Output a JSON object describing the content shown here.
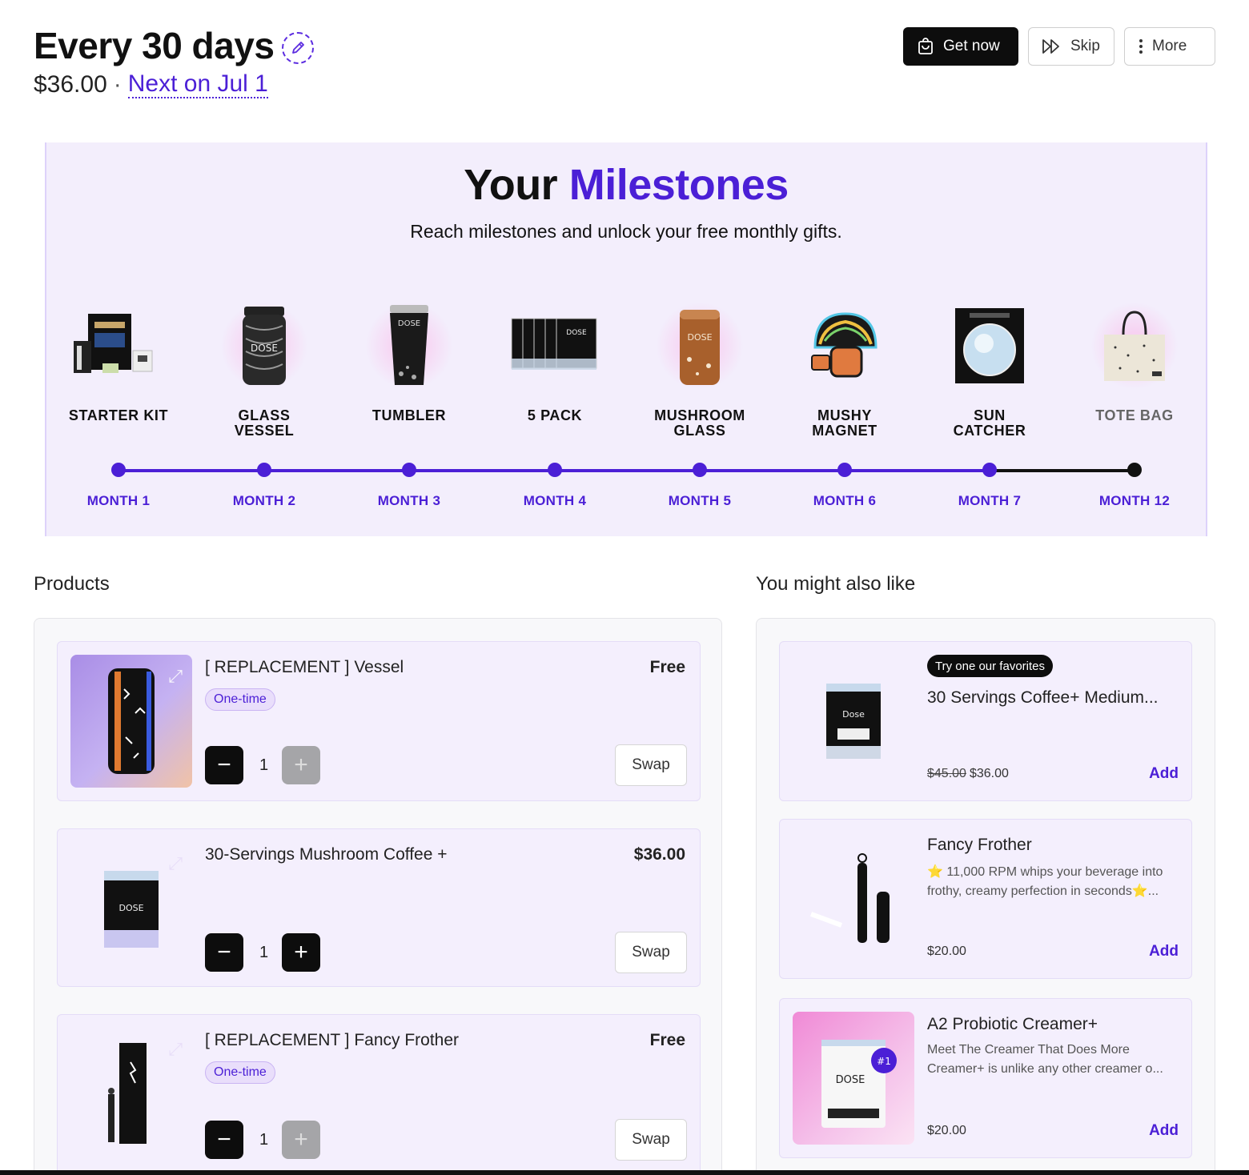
{
  "header": {
    "title": "Every 30 days",
    "price": "$36.00",
    "separator": "·",
    "next_label": "Next on Jul 1",
    "actions": {
      "get_now": "Get now",
      "skip": "Skip",
      "more": "More"
    }
  },
  "milestones": {
    "title_part1": "Your",
    "title_part2": "Milestones",
    "subtitle": "Reach milestones and unlock your free monthly gifts.",
    "items": [
      {
        "name_line1": "STARTER KIT",
        "name_line2": "",
        "month": "MONTH 1"
      },
      {
        "name_line1": "GLASS",
        "name_line2": "VESSEL",
        "month": "MONTH 2"
      },
      {
        "name_line1": "TUMBLER",
        "name_line2": "",
        "month": "MONTH 3"
      },
      {
        "name_line1": "5 PACK",
        "name_line2": "",
        "month": "MONTH 4"
      },
      {
        "name_line1": "MUSHROOM",
        "name_line2": "GLASS",
        "month": "MONTH 5"
      },
      {
        "name_line1": "MUSHY",
        "name_line2": "MAGNET",
        "month": "MONTH 6"
      },
      {
        "name_line1": "SUN",
        "name_line2": "CATCHER",
        "month": "MONTH 7"
      },
      {
        "name_line1": "TOTE BAG",
        "name_line2": "",
        "month": "MONTH 12"
      }
    ],
    "colors": {
      "reached": "#4b1fd6",
      "upcoming": "#111111"
    }
  },
  "products": {
    "section_title": "Products",
    "items": [
      {
        "name": "[ REPLACEMENT ] Vessel",
        "price": "Free",
        "pill": "One-time",
        "qty": "1",
        "swap": "Swap"
      },
      {
        "name": "30-Servings Mushroom Coffee +",
        "price": "$36.00",
        "pill": "",
        "qty": "1",
        "swap": "Swap"
      },
      {
        "name": "[ REPLACEMENT ] Fancy Frother",
        "price": "Free",
        "pill": "One-time",
        "qty": "1",
        "swap": "Swap"
      }
    ]
  },
  "recommendations": {
    "section_title": "You might also like",
    "items": [
      {
        "badge": "Try one our favorites",
        "name": "30 Servings Coffee+ Medium...",
        "desc1": "",
        "desc2": "",
        "old_price": "$45.00",
        "price": "$36.00",
        "add": "Add"
      },
      {
        "badge": "",
        "name": "Fancy Frother",
        "desc1": "⭐ 11,000 RPM whips your beverage into",
        "desc2": "frothy, creamy perfection in seconds⭐...",
        "old_price": "",
        "price": "$20.00",
        "add": "Add"
      },
      {
        "badge": "",
        "name": "A2 Probiotic Creamer+",
        "desc1": "Meet The Creamer That Does More",
        "desc2": "Creamer+ is unlike any other creamer o...",
        "old_price": "",
        "price": "$20.00",
        "add": "Add"
      }
    ]
  },
  "theme": {
    "accent": "#4b1fd6",
    "milestone_bg": "#f3eefc",
    "card_bg": "#f4effd"
  }
}
